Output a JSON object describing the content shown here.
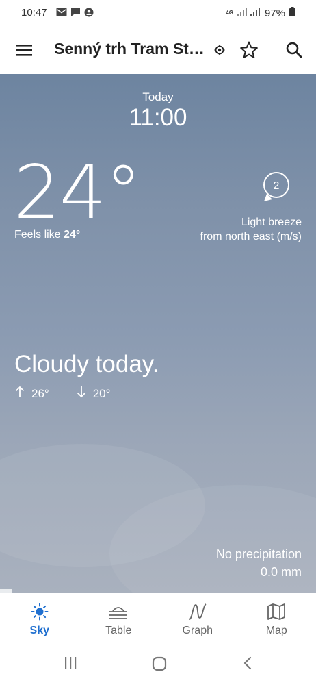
{
  "status_bar": {
    "time": "10:47",
    "network": "4G",
    "battery": "97%",
    "notification_icons": [
      "gmail-icon",
      "message-icon",
      "account-icon"
    ]
  },
  "app_bar": {
    "title": "Senný trh Tram St…",
    "icons": [
      "menu-icon",
      "location-icon",
      "star-icon",
      "search-icon"
    ]
  },
  "forecast": {
    "day": "Today",
    "hour": "11:00",
    "temperature": "24°",
    "feels_like_label": "Feels like",
    "feels_like_value": "24°",
    "wind_speed": "2",
    "wind_line1": "Light breeze",
    "wind_line2": "from north east (m/s)",
    "summary": "Cloudy today.",
    "high": "26°",
    "low": "20°",
    "precip_line1": "No precipitation",
    "precip_line2": "0.0 mm"
  },
  "bottom_nav": {
    "items": [
      {
        "label": "Sky",
        "icon": "sun-icon",
        "active": true
      },
      {
        "label": "Table",
        "icon": "table-icon",
        "active": false
      },
      {
        "label": "Graph",
        "icon": "graph-icon",
        "active": false
      },
      {
        "label": "Map",
        "icon": "map-icon",
        "active": false
      }
    ]
  },
  "colors": {
    "accent": "#1f6fcf",
    "sky_top": "#6d84a0",
    "sky_bottom": "#a9b1be"
  }
}
